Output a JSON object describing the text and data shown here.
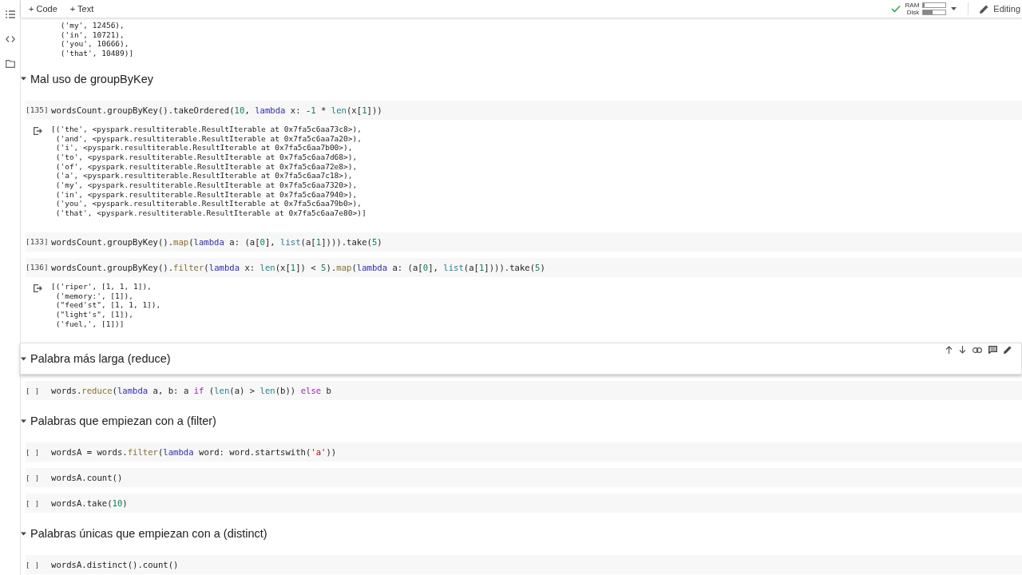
{
  "toolbar": {
    "buttons": [
      "+ Code",
      "+ Text"
    ],
    "status_ok": true,
    "meters": [
      {
        "label": "RAM",
        "level": 0.06
      },
      {
        "label": "Disk",
        "level": 0.4
      }
    ],
    "mode": "Editing"
  },
  "cells": [
    {
      "kind": "output",
      "lines": [
        " ('my', 12456),",
        " ('in', 10721),",
        " ('you', 10666),",
        " ('that', 10489)]"
      ]
    },
    {
      "kind": "heading",
      "text": "Mal uso de groupByKey",
      "expanded": true,
      "selected": false
    },
    {
      "kind": "code",
      "count": "[135]",
      "code": [
        {
          "t": "wordsCount.groupByKey().takeOrdered(",
          "kind": "plain"
        },
        {
          "t": "10",
          "kind": "number"
        },
        {
          "t": ", ",
          "kind": "plain"
        },
        {
          "t": "lambda",
          "kind": "keyword"
        },
        {
          "t": " x: -",
          "kind": "plain"
        },
        {
          "t": "1",
          "kind": "number"
        },
        {
          "t": " * ",
          "kind": "plain"
        },
        {
          "t": "len",
          "kind": "builtin"
        },
        {
          "t": "(x[",
          "kind": "plain"
        },
        {
          "t": "1",
          "kind": "number"
        },
        {
          "t": "]))",
          "kind": "plain"
        }
      ],
      "output": [
        "[('the', <pyspark.resultiterable.ResultIterable at 0x7fa5c6aa73c8>),",
        " ('and', <pyspark.resultiterable.ResultIterable at 0x7fa5c6aa7a20>),",
        " ('i', <pyspark.resultiterable.ResultIterable at 0x7fa5c6aa7b00>),",
        " ('to', <pyspark.resultiterable.ResultIterable at 0x7fa5c6aa7d68>),",
        " ('of', <pyspark.resultiterable.ResultIterable at 0x7fa5c6aa72e8>),",
        " ('a', <pyspark.resultiterable.ResultIterable at 0x7fa5c6aa7c18>),",
        " ('my', <pyspark.resultiterable.ResultIterable at 0x7fa5c6aa7320>),",
        " ('in', <pyspark.resultiterable.ResultIterable at 0x7fa5c6aa7940>),",
        " ('you', <pyspark.resultiterable.ResultIterable at 0x7fa5c6aa79b0>),",
        " ('that', <pyspark.resultiterable.ResultIterable at 0x7fa5c6aa7e80>)]"
      ]
    },
    {
      "kind": "code",
      "count": "[133]",
      "code": [
        {
          "t": "wordsCount.groupByKey().",
          "kind": "plain"
        },
        {
          "t": "map",
          "kind": "method"
        },
        {
          "t": "(",
          "kind": "plain"
        },
        {
          "t": "lambda",
          "kind": "keyword"
        },
        {
          "t": " a: (a[",
          "kind": "plain"
        },
        {
          "t": "0",
          "kind": "number"
        },
        {
          "t": "], ",
          "kind": "plain"
        },
        {
          "t": "list",
          "kind": "builtin"
        },
        {
          "t": "(a[",
          "kind": "plain"
        },
        {
          "t": "1",
          "kind": "number"
        },
        {
          "t": "]))).take(",
          "kind": "plain"
        },
        {
          "t": "5",
          "kind": "number"
        },
        {
          "t": ")",
          "kind": "plain"
        }
      ]
    },
    {
      "kind": "code",
      "count": "[136]",
      "code": [
        {
          "t": "wordsCount.groupByKey().",
          "kind": "plain"
        },
        {
          "t": "filter",
          "kind": "method"
        },
        {
          "t": "(",
          "kind": "plain"
        },
        {
          "t": "lambda",
          "kind": "keyword"
        },
        {
          "t": " x: ",
          "kind": "plain"
        },
        {
          "t": "len",
          "kind": "builtin"
        },
        {
          "t": "(x[",
          "kind": "plain"
        },
        {
          "t": "1",
          "kind": "number"
        },
        {
          "t": "]) < ",
          "kind": "plain"
        },
        {
          "t": "5",
          "kind": "number"
        },
        {
          "t": ").",
          "kind": "plain"
        },
        {
          "t": "map",
          "kind": "method"
        },
        {
          "t": "(",
          "kind": "plain"
        },
        {
          "t": "lambda",
          "kind": "keyword"
        },
        {
          "t": " a: (a[",
          "kind": "plain"
        },
        {
          "t": "0",
          "kind": "number"
        },
        {
          "t": "], ",
          "kind": "plain"
        },
        {
          "t": "list",
          "kind": "builtin"
        },
        {
          "t": "(a[",
          "kind": "plain"
        },
        {
          "t": "1",
          "kind": "number"
        },
        {
          "t": "]))).take(",
          "kind": "plain"
        },
        {
          "t": "5",
          "kind": "number"
        },
        {
          "t": ")",
          "kind": "plain"
        }
      ],
      "output": [
        "[('riper', [1, 1, 1]),",
        " ('memory:', [1]),",
        " (\"feed'st\", [1, 1, 1]),",
        " (\"light's\", [1]),",
        " ('fuel,', [1])]"
      ]
    },
    {
      "kind": "heading",
      "text": "Palabra más larga (reduce)",
      "expanded": true,
      "selected": true
    },
    {
      "kind": "code",
      "count": "[ ]",
      "code": [
        {
          "t": "words.",
          "kind": "plain"
        },
        {
          "t": "reduce",
          "kind": "method"
        },
        {
          "t": "(",
          "kind": "plain"
        },
        {
          "t": "lambda",
          "kind": "keyword"
        },
        {
          "t": " a, b: a ",
          "kind": "plain"
        },
        {
          "t": "if",
          "kind": "control"
        },
        {
          "t": " (",
          "kind": "plain"
        },
        {
          "t": "len",
          "kind": "builtin"
        },
        {
          "t": "(a) > ",
          "kind": "plain"
        },
        {
          "t": "len",
          "kind": "builtin"
        },
        {
          "t": "(b)) ",
          "kind": "plain"
        },
        {
          "t": "else",
          "kind": "control"
        },
        {
          "t": " b",
          "kind": "plain"
        }
      ]
    },
    {
      "kind": "heading",
      "text": "Palabras que empiezan con a (filter)",
      "expanded": true,
      "selected": false
    },
    {
      "kind": "code",
      "count": "[ ]",
      "code": [
        {
          "t": "wordsA = words.",
          "kind": "plain"
        },
        {
          "t": "filter",
          "kind": "method"
        },
        {
          "t": "(",
          "kind": "plain"
        },
        {
          "t": "lambda",
          "kind": "keyword"
        },
        {
          "t": " word: word.startswith(",
          "kind": "plain"
        },
        {
          "t": "'a'",
          "kind": "string"
        },
        {
          "t": "))",
          "kind": "plain"
        }
      ]
    },
    {
      "kind": "code",
      "count": "[ ]",
      "code": [
        {
          "t": "wordsA.count()",
          "kind": "plain"
        }
      ]
    },
    {
      "kind": "code",
      "count": "[ ]",
      "code": [
        {
          "t": "wordsA.take(",
          "kind": "plain"
        },
        {
          "t": "10",
          "kind": "number"
        },
        {
          "t": ")",
          "kind": "plain"
        }
      ]
    },
    {
      "kind": "heading",
      "text": "Palabras únicas que empiezan con a (distinct)",
      "expanded": true,
      "selected": false
    },
    {
      "kind": "code",
      "count": "[ ]",
      "code": [
        {
          "t": "wordsA.distinct().count()",
          "kind": "plain"
        }
      ]
    }
  ]
}
